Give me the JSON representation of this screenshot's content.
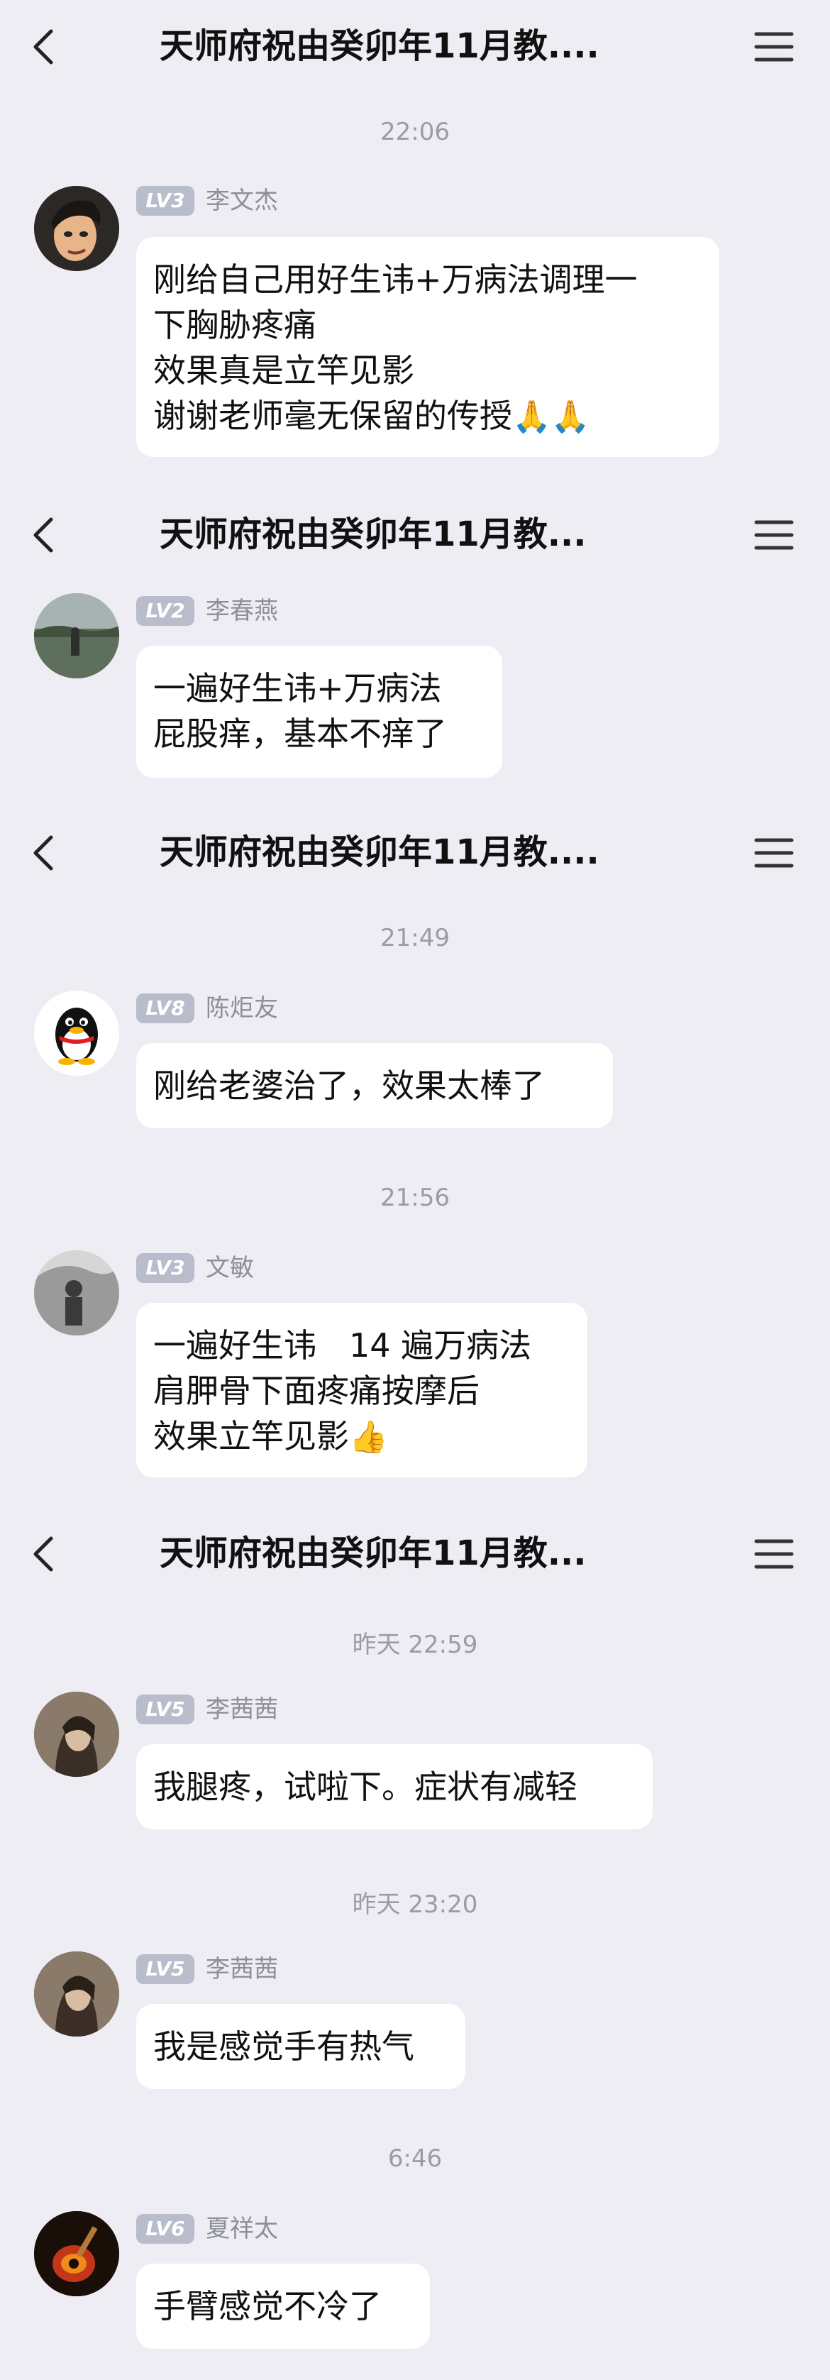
{
  "chat_title": "天师府祝由癸卯年11月教...",
  "chat_title_dotted": "天师府祝由癸卯年11月教....",
  "times": {
    "t1": "22:06",
    "t3a": "21:49",
    "t3b": "21:56",
    "t4a": "昨天 22:59",
    "t4b": "昨天 23:20",
    "t4c": "6:46"
  },
  "messages": {
    "m1": {
      "level": "LV3",
      "name": "李文杰",
      "lines": [
        "刚给自己用好生讳+万病法调理一",
        "下胸胁疼痛",
        "效果真是立竿见影",
        "谢谢老师毫无保留的传授"
      ],
      "emoji": "🙏🙏"
    },
    "m2": {
      "level": "LV2",
      "name": "李春燕",
      "lines": [
        "一遍好生讳+万病法",
        "屁股痒，基本不痒了"
      ]
    },
    "m3": {
      "level": "LV8",
      "name": "陈炬友",
      "lines": [
        "刚给老婆治了，效果太棒了"
      ]
    },
    "m4": {
      "level": "LV3",
      "name": "文敏",
      "lines": [
        "一遍好生讳　14 遍万病法",
        "肩胛骨下面疼痛按摩后",
        "效果立竿见影"
      ],
      "emoji": "👍"
    },
    "m5": {
      "level": "LV5",
      "name": "李茜茜",
      "lines": [
        "我腿疼，试啦下。症状有减轻"
      ]
    },
    "m6": {
      "level": "LV5",
      "name": "李茜茜",
      "lines": [
        "我是感觉手有热气"
      ]
    },
    "m7": {
      "level": "LV6",
      "name": "夏祥太",
      "lines": [
        "手臂感觉不冷了"
      ]
    }
  },
  "icons": {
    "back": "chevron-left-icon",
    "menu": "hamburger-menu-icon"
  },
  "colors": {
    "background": "#ededf3",
    "bubble": "#ffffff",
    "level_badge": "#b9bdcb",
    "timestamp": "#9b9ba3"
  }
}
